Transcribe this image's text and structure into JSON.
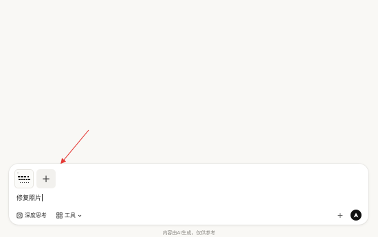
{
  "composer": {
    "input_value": "修复照片",
    "attachment_thumbnail_icon": "image-thumbnail-icon",
    "add_attachment_icon": "plus-icon"
  },
  "toolbar": {
    "deep_think_label": "深度思考",
    "tools_label": "工具",
    "more_icon": "plus-icon",
    "send_icon": "send-arrow-icon"
  },
  "footer": {
    "disclaimer": "内容由AI生成，仅供参考"
  },
  "colors": {
    "page_bg": "#f9f8f5",
    "send_button": "#111111",
    "annotation_arrow": "#e53935"
  }
}
